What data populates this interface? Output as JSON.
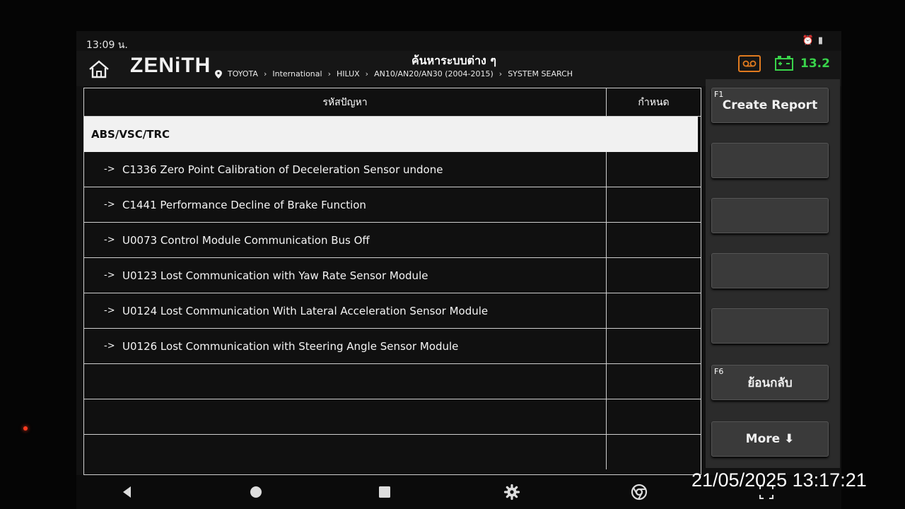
{
  "status_bar": {
    "time": "13:09 น.",
    "icons": [
      "alarm-icon",
      "battery-icon"
    ]
  },
  "header": {
    "logo": "ZENiTH",
    "title": "ค้นหาระบบต่าง ๆ",
    "breadcrumb": [
      "TOYOTA",
      "International",
      "HILUX",
      "AN10/AN20/AN30 (2004-2015)",
      "SYSTEM SEARCH"
    ],
    "voltage": "13.2",
    "colors": {
      "voltage": "#39d34a",
      "record_icon": "#e07a1f"
    }
  },
  "table": {
    "headers": {
      "code": "รหัสปัญหา",
      "define": "กำหนด"
    },
    "group": "ABS/VSC/TRC",
    "arrow": "->",
    "rows": [
      {
        "text": "C1336 Zero Point Calibration of Deceleration Sensor undone"
      },
      {
        "text": "C1441 Performance Decline of Brake Function"
      },
      {
        "text": "U0073 Control Module Communication Bus Off"
      },
      {
        "text": "U0123 Lost Communication with Yaw Rate Sensor Module"
      },
      {
        "text": "U0124 Lost Communication With Lateral Acceleration Sensor Module"
      },
      {
        "text": "U0126 Lost Communication with Steering Angle Sensor Module"
      }
    ]
  },
  "sidebar": {
    "f1": {
      "key": "F1",
      "label": "Create Report"
    },
    "f6": {
      "key": "F6",
      "label": "ย้อนกลับ"
    },
    "more": {
      "label": "More ⬇"
    }
  },
  "navbar": {
    "icons": [
      "back-icon",
      "home-circle-icon",
      "recents-icon",
      "settings-icon",
      "chrome-icon",
      "screenshot-icon"
    ]
  },
  "overlay": {
    "timestamp": "21/05/2025 13:17:21"
  }
}
